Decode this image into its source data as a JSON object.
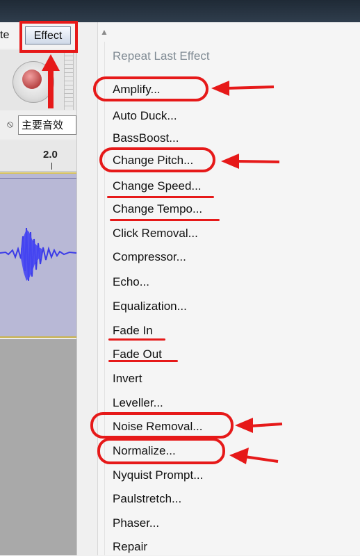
{
  "app": {
    "menu_partial": "te",
    "effect_menu_label": "Effect",
    "input_device_label": "主要音效",
    "ruler_value": "2.0"
  },
  "menu": {
    "items": [
      {
        "label": "Repeat Last Effect",
        "enabled": false
      },
      {
        "label": "Amplify...",
        "enabled": true
      },
      {
        "label": "Auto Duck...",
        "enabled": true
      },
      {
        "label": "BassBoost...",
        "enabled": true
      },
      {
        "label": "Change Pitch...",
        "enabled": true
      },
      {
        "label": "Change Speed...",
        "enabled": true
      },
      {
        "label": "Change Tempo...",
        "enabled": true
      },
      {
        "label": "Click Removal...",
        "enabled": true
      },
      {
        "label": "Compressor...",
        "enabled": true
      },
      {
        "label": "Echo...",
        "enabled": true
      },
      {
        "label": "Equalization...",
        "enabled": true
      },
      {
        "label": "Fade In",
        "enabled": true
      },
      {
        "label": "Fade Out",
        "enabled": true
      },
      {
        "label": "Invert",
        "enabled": true
      },
      {
        "label": "Leveller...",
        "enabled": true
      },
      {
        "label": "Noise Removal...",
        "enabled": true
      },
      {
        "label": "Normalize...",
        "enabled": true
      },
      {
        "label": "Nyquist Prompt...",
        "enabled": true
      },
      {
        "label": "Paulstretch...",
        "enabled": true
      },
      {
        "label": "Phaser...",
        "enabled": true
      },
      {
        "label": "Repair",
        "enabled": true
      }
    ]
  },
  "icons": {
    "scroll_up": "scroll-up-icon",
    "mic": "microphone-icon",
    "record": "record-icon"
  },
  "colors": {
    "annotation_red": "#e61919",
    "waveform_blue": "#3a3ae8",
    "track_bg": "#b8b8d6",
    "disabled_text": "#7f8a93"
  }
}
